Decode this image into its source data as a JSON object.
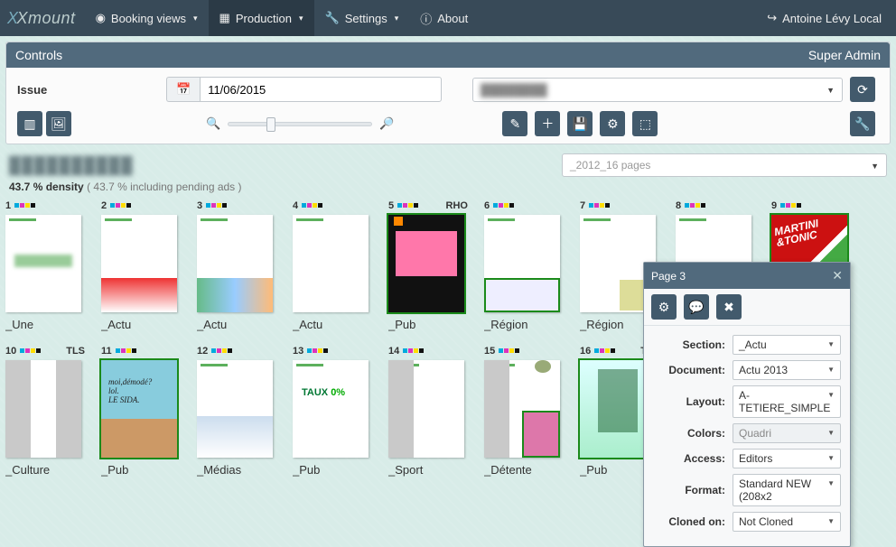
{
  "nav": {
    "brand": "Xmount",
    "items": [
      {
        "icon": "eye",
        "label": "Booking views"
      },
      {
        "icon": "grid",
        "label": "Production"
      },
      {
        "icon": "wrench",
        "label": "Settings"
      },
      {
        "icon": "info",
        "label": "About"
      }
    ],
    "user_icon": "logout",
    "user": "Antoine Lévy Local"
  },
  "controls": {
    "title": "Controls",
    "role": "Super Admin",
    "issue_label": "Issue",
    "date": "11/06/2015",
    "region_placeholder": ""
  },
  "subheader": {
    "blurred_title": "",
    "layout_select": "_2012_16 pages",
    "density_value": "43.7 % density",
    "density_pending": "( 43.7 % including pending ads )"
  },
  "pages": [
    {
      "n": 1,
      "tag": "",
      "label": "_Une",
      "green": false
    },
    {
      "n": 2,
      "tag": "",
      "label": "_Actu",
      "green": false
    },
    {
      "n": 3,
      "tag": "",
      "label": "_Actu",
      "green": false
    },
    {
      "n": 4,
      "tag": "",
      "label": "_Actu",
      "green": false
    },
    {
      "n": 5,
      "tag": "RHO",
      "label": "_Pub",
      "green": true
    },
    {
      "n": 6,
      "tag": "",
      "label": "_Région",
      "green": false
    },
    {
      "n": 7,
      "tag": "",
      "label": "_Région",
      "green": false
    },
    {
      "n": 8,
      "tag": "",
      "label": "",
      "green": false
    },
    {
      "n": 9,
      "tag": "",
      "label": "",
      "green": true
    },
    {
      "n": 10,
      "tag": "TLS",
      "label": "_Culture",
      "green": false
    },
    {
      "n": 11,
      "tag": "",
      "label": "_Pub",
      "green": true
    },
    {
      "n": 12,
      "tag": "",
      "label": "_Médias",
      "green": false
    },
    {
      "n": 13,
      "tag": "",
      "label": "_Pub",
      "green": false
    },
    {
      "n": 14,
      "tag": "",
      "label": "_Sport",
      "green": false
    },
    {
      "n": 15,
      "tag": "",
      "label": "_Détente",
      "green": false
    },
    {
      "n": 16,
      "tag": "TLS",
      "label": "_Pub",
      "green": true
    }
  ],
  "popup": {
    "title": "Page 3",
    "fields": {
      "section_label": "Section:",
      "section_value": "_Actu",
      "document_label": "Document:",
      "document_value": "Actu 2013",
      "layout_label": "Layout:",
      "layout_value": "A-TETIERE_SIMPLE",
      "colors_label": "Colors:",
      "colors_value": "Quadri",
      "access_label": "Access:",
      "access_value": "Editors",
      "format_label": "Format:",
      "format_value": "Standard NEW (208x2",
      "cloned_label": "Cloned on:",
      "cloned_value": "Not Cloned"
    }
  }
}
